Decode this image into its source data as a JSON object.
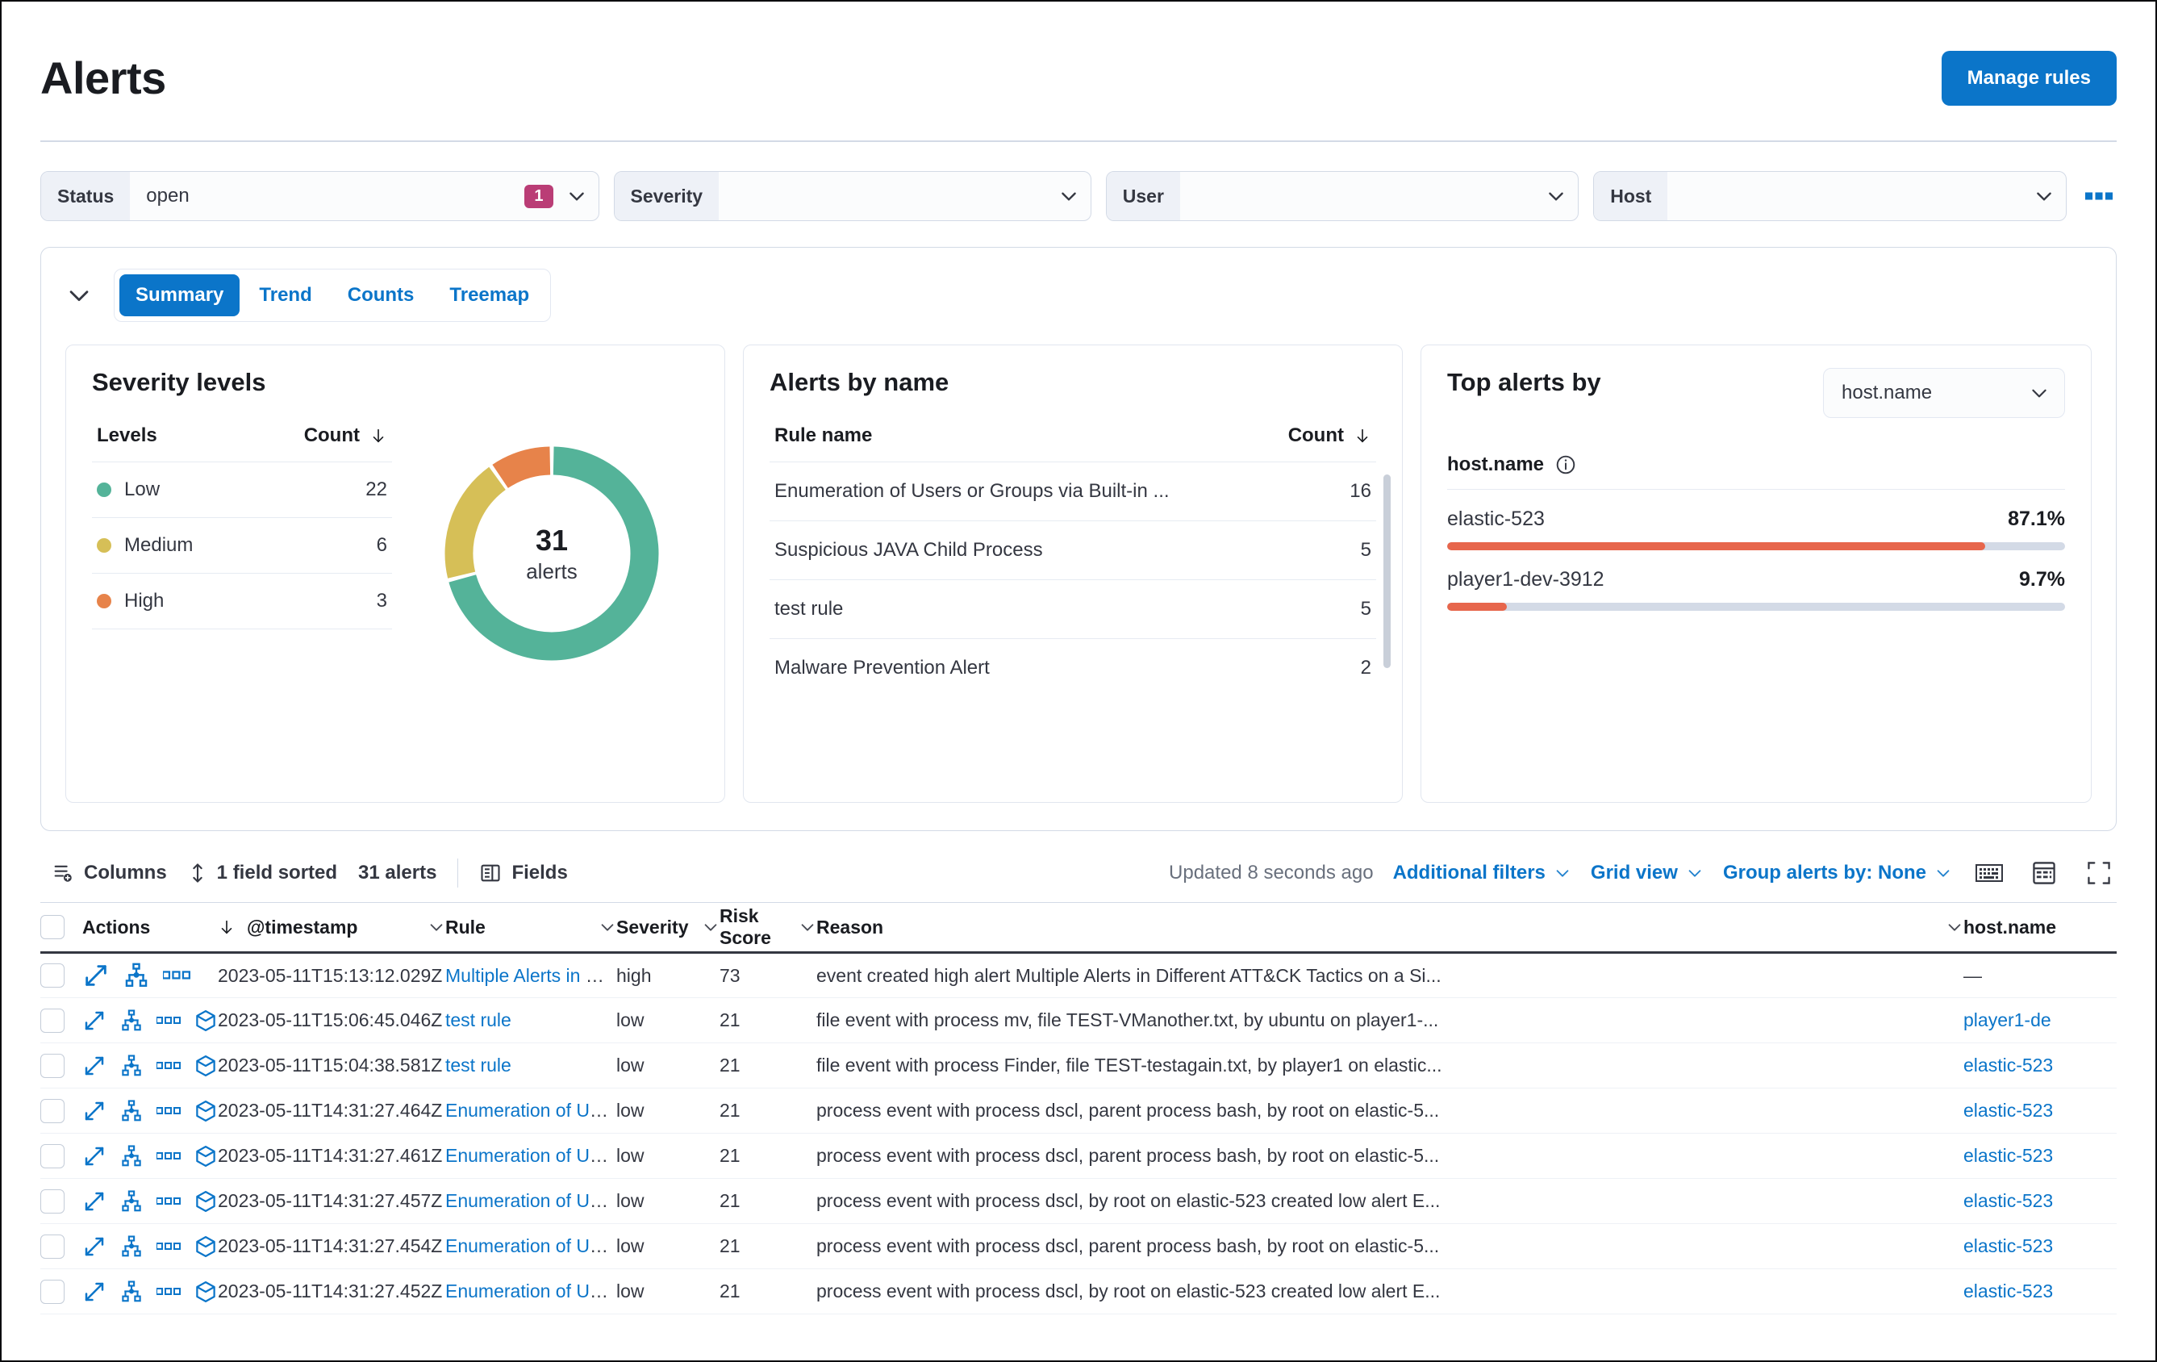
{
  "header": {
    "title": "Alerts",
    "manage_rules_label": "Manage rules"
  },
  "filters": [
    {
      "label": "Status",
      "value": "open",
      "badge": "1",
      "name": "status"
    },
    {
      "label": "Severity",
      "value": "",
      "badge": "",
      "name": "severity"
    },
    {
      "label": "User",
      "value": "",
      "badge": "",
      "name": "user"
    },
    {
      "label": "Host",
      "value": "",
      "badge": "",
      "name": "host"
    }
  ],
  "summary": {
    "tabs": [
      {
        "label": "Summary",
        "active": true
      },
      {
        "label": "Trend",
        "active": false
      },
      {
        "label": "Counts",
        "active": false
      },
      {
        "label": "Treemap",
        "active": false
      }
    ],
    "severity_card": {
      "title": "Severity levels",
      "col_levels": "Levels",
      "col_count": "Count",
      "rows": [
        {
          "level": "Low",
          "count": "22",
          "color": "#54b399"
        },
        {
          "level": "Medium",
          "count": "6",
          "color": "#d6bf57"
        },
        {
          "level": "High",
          "count": "3",
          "color": "#e7834a"
        }
      ],
      "donut_total": "31",
      "donut_label": "alerts"
    },
    "name_card": {
      "title": "Alerts by name",
      "col_rule": "Rule name",
      "col_count": "Count",
      "rows": [
        {
          "rule": "Enumeration of Users or Groups via Built-in ...",
          "count": "16"
        },
        {
          "rule": "Suspicious JAVA Child Process",
          "count": "5"
        },
        {
          "rule": "test rule",
          "count": "5"
        },
        {
          "rule": "Malware Prevention Alert",
          "count": "2"
        }
      ]
    },
    "top_card": {
      "title": "Top alerts by",
      "select_value": "host.name",
      "field_label": "host.name",
      "rows": [
        {
          "name": "elastic-523",
          "pct": "87.1%",
          "width": 87.1
        },
        {
          "name": "player1-dev-3912",
          "pct": "9.7%",
          "width": 9.7
        }
      ]
    }
  },
  "grid_toolbar": {
    "columns_label": "Columns",
    "sorted_label": "1 field sorted",
    "alerts_count_label": "31 alerts",
    "fields_label": "Fields",
    "updated_label": "Updated 8 seconds ago",
    "additional_filters_label": "Additional filters",
    "grid_view_label": "Grid view",
    "group_alerts_label": "Group alerts by: None"
  },
  "grid": {
    "columns": [
      {
        "key": "actions",
        "label": "Actions"
      },
      {
        "key": "timestamp",
        "label": "@timestamp"
      },
      {
        "key": "rule",
        "label": "Rule"
      },
      {
        "key": "severity",
        "label": "Severity"
      },
      {
        "key": "risk_score",
        "label": "Risk Score"
      },
      {
        "key": "reason",
        "label": "Reason"
      },
      {
        "key": "host_name",
        "label": "host.name"
      }
    ],
    "rows": [
      {
        "timestamp": "2023-05-11T15:13:12.029Z",
        "rule": "Multiple Alerts in Different ...",
        "severity": "high",
        "risk_score": "73",
        "reason": "event created high alert Multiple Alerts in Different ATT&CK Tactics on a Si...",
        "host_name": "—",
        "host_is_link": false,
        "has_session_icon": false
      },
      {
        "timestamp": "2023-05-11T15:06:45.046Z",
        "rule": "test rule",
        "severity": "low",
        "risk_score": "21",
        "reason": "file event with process mv, file TEST-VManother.txt, by ubuntu on player1-...",
        "host_name": "player1-de",
        "host_is_link": true,
        "has_session_icon": true
      },
      {
        "timestamp": "2023-05-11T15:04:38.581Z",
        "rule": "test rule",
        "severity": "low",
        "risk_score": "21",
        "reason": "file event with process Finder, file TEST-testagain.txt, by player1 on elastic...",
        "host_name": "elastic-523",
        "host_is_link": true,
        "has_session_icon": true
      },
      {
        "timestamp": "2023-05-11T14:31:27.464Z",
        "rule": "Enumeration of Users or Gr...",
        "severity": "low",
        "risk_score": "21",
        "reason": "process event with process dscl, parent process bash, by root on elastic-5...",
        "host_name": "elastic-523",
        "host_is_link": true,
        "has_session_icon": true
      },
      {
        "timestamp": "2023-05-11T14:31:27.461Z",
        "rule": "Enumeration of Users or Gr...",
        "severity": "low",
        "risk_score": "21",
        "reason": "process event with process dscl, parent process bash, by root on elastic-5...",
        "host_name": "elastic-523",
        "host_is_link": true,
        "has_session_icon": true
      },
      {
        "timestamp": "2023-05-11T14:31:27.457Z",
        "rule": "Enumeration of Users or Gr...",
        "severity": "low",
        "risk_score": "21",
        "reason": "process event with process dscl, by root on elastic-523 created low alert E...",
        "host_name": "elastic-523",
        "host_is_link": true,
        "has_session_icon": true
      },
      {
        "timestamp": "2023-05-11T14:31:27.454Z",
        "rule": "Enumeration of Users or Gr...",
        "severity": "low",
        "risk_score": "21",
        "reason": "process event with process dscl, parent process bash, by root on elastic-5...",
        "host_name": "elastic-523",
        "host_is_link": true,
        "has_session_icon": true
      },
      {
        "timestamp": "2023-05-11T14:31:27.452Z",
        "rule": "Enumeration of Users or Gr...",
        "severity": "low",
        "risk_score": "21",
        "reason": "process event with process dscl, by root on elastic-523 created low alert E...",
        "host_name": "elastic-523",
        "host_is_link": true,
        "has_session_icon": true
      }
    ]
  },
  "chart_data": {
    "type": "pie",
    "title": "Severity levels",
    "labels": [
      "Low",
      "Medium",
      "High"
    ],
    "values": [
      22,
      6,
      3
    ],
    "colors": [
      "#54b399",
      "#d6bf57",
      "#e7834a"
    ],
    "total": 31,
    "center_label": "31 alerts",
    "legend_position": "left"
  },
  "colors": {
    "accent": "#0b75c9",
    "badge": "#ba3d76",
    "bar": "#e7664c",
    "low": "#54b399",
    "medium": "#d6bf57",
    "high": "#e7834a"
  }
}
